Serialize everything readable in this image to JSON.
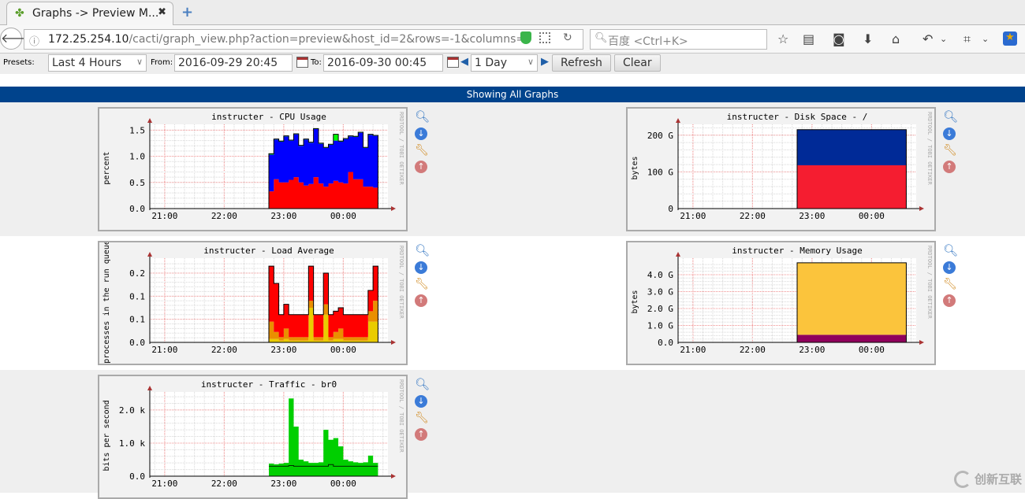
{
  "browser": {
    "tab_title": "Graphs -> Preview M...",
    "url_host": "172.25.254.10",
    "url_path": "/cacti/graph_view.php?action=preview&host_id=2&rows=-1&columns=-",
    "search_placeholder": "百度 <Ctrl+K>"
  },
  "toolbar": {
    "presets_label": "Presets:",
    "preset_value": "Last 4 Hours",
    "from_label": "From:",
    "from_value": "2016-09-29 20:45",
    "to_label": "To:",
    "to_value": "2016-09-30 00:45",
    "span_value": "1 Day",
    "refresh_label": "Refresh",
    "clear_label": "Clear"
  },
  "banner": "Showing All Graphs",
  "watermark": "RRDTOOL / TOBI OETIKER",
  "logo_text": "创新互联",
  "x_ticks": [
    "21:00",
    "22:00",
    "23:00",
    "00:00"
  ],
  "graphs": [
    {
      "title": "instructer - CPU Usage",
      "ylabel": "percent",
      "ymax": 1.55,
      "yticks": [
        {
          "v": 0,
          "l": "0.0"
        },
        {
          "v": 0.5,
          "l": "0.5"
        },
        {
          "v": 1.0,
          "l": "1.0"
        },
        {
          "v": 1.5,
          "l": "1.5"
        }
      ],
      "start": "22:45",
      "end": "00:35",
      "series": [
        {
          "color": "#ff0000",
          "values": [
            0.33,
            0.56,
            0.5,
            0.5,
            0.55,
            0.6,
            0.5,
            0.44,
            0.47,
            0.6,
            0.48,
            0.42,
            0.48,
            0.53,
            0.5,
            0.48,
            0.7,
            0.56,
            0.56,
            0.42,
            0.42,
            0.4
          ]
        },
        {
          "color": "#0000ff",
          "values": [
            0.7,
            0.76,
            0.78,
            0.88,
            0.75,
            0.82,
            0.7,
            0.88,
            0.79,
            0.92,
            0.76,
            0.74,
            0.74,
            0.77,
            0.78,
            0.85,
            0.68,
            0.81,
            0.89,
            0.74,
            0.99,
            0.99
          ]
        },
        {
          "color": "#00ff00",
          "values": [
            0.02,
            0.01,
            0.01,
            0.01,
            0.01,
            0.01,
            0.01,
            0.01,
            0.01,
            0.01,
            0.01,
            0.01,
            0.01,
            0.12,
            0.01,
            0.01,
            0.01,
            0.01,
            0.01,
            0.01,
            0.01,
            0.01
          ]
        }
      ]
    },
    {
      "title": "instructer - Disk Space - /",
      "ylabel": "bytes",
      "ymax": 221,
      "yticks": [
        {
          "v": 0,
          "l": "0"
        },
        {
          "v": 100,
          "l": "100 G"
        },
        {
          "v": 200,
          "l": "200 G"
        }
      ],
      "start": "22:45",
      "end": "00:35",
      "series": [
        {
          "color": "#f51d30",
          "values": [
            118,
            118,
            118,
            118,
            118,
            118,
            118,
            118,
            118,
            118,
            118,
            118,
            118,
            118,
            118,
            118,
            118,
            118,
            118,
            118,
            118,
            118
          ]
        },
        {
          "color": "#002a97",
          "values": [
            97,
            97,
            97,
            97,
            97,
            97,
            97,
            97,
            97,
            97,
            97,
            97,
            97,
            97,
            97,
            97,
            97,
            97,
            97,
            97,
            97,
            97
          ]
        }
      ]
    },
    {
      "title": "instructer - Load Average",
      "ylabel": "processes in the run queue",
      "ymax": 0.234,
      "yticks": [
        {
          "v": 0,
          "l": "0.0"
        },
        {
          "v": 0.0667,
          "l": "0.1"
        },
        {
          "v": 0.1333,
          "l": "0.1"
        },
        {
          "v": 0.2,
          "l": "0.2"
        }
      ],
      "start": "22:45",
      "end": "00:35",
      "series": [
        {
          "color": "#eacc00",
          "values": [
            0.01,
            0.01,
            0.005,
            0.01,
            0.005,
            0.005,
            0.005,
            0.005,
            0.1,
            0.005,
            0.005,
            0.08,
            0.005,
            0.01,
            0.01,
            0.005,
            0.005,
            0.005,
            0.005,
            0.005,
            0.06,
            0.06
          ]
        },
        {
          "color": "#ea8f00",
          "values": [
            0.05,
            0.02,
            0.01,
            0.03,
            0.01,
            0.01,
            0.01,
            0.01,
            0.02,
            0.01,
            0.01,
            0.03,
            0.01,
            0.02,
            0.03,
            0.01,
            0.01,
            0.01,
            0.01,
            0.01,
            0.03,
            0.06
          ]
        },
        {
          "color": "#ff0000",
          "values": [
            0.16,
            0.14,
            0.065,
            0.07,
            0.065,
            0.065,
            0.065,
            0.065,
            0.1,
            0.065,
            0.065,
            0.09,
            0.065,
            0.06,
            0.06,
            0.065,
            0.065,
            0.065,
            0.065,
            0.065,
            0.06,
            0.1
          ]
        }
      ]
    },
    {
      "title": "instructer - Memory Usage",
      "ylabel": "bytes",
      "ymax": 4.79,
      "yticks": [
        {
          "v": 0,
          "l": "0.0"
        },
        {
          "v": 1,
          "l": "1.0 G"
        },
        {
          "v": 2,
          "l": "2.0 G"
        },
        {
          "v": 3,
          "l": "3.0 G"
        },
        {
          "v": 4,
          "l": "4.0 G"
        }
      ],
      "start": "22:45",
      "end": "00:35",
      "series": [
        {
          "color": "#8f005c",
          "values": [
            0.45,
            0.45,
            0.45,
            0.45,
            0.45,
            0.45,
            0.45,
            0.45,
            0.45,
            0.45,
            0.45,
            0.45,
            0.45,
            0.45,
            0.45,
            0.45,
            0.45,
            0.45,
            0.45,
            0.45,
            0.45,
            0.45
          ]
        },
        {
          "color": "#fbc43c",
          "values": [
            4.25,
            4.25,
            4.25,
            4.25,
            4.25,
            4.25,
            4.25,
            4.25,
            4.25,
            4.25,
            4.25,
            4.25,
            4.25,
            4.25,
            4.25,
            4.25,
            4.25,
            4.25,
            4.25,
            4.25,
            4.25,
            4.25
          ]
        }
      ]
    },
    {
      "title": "instructer - Traffic - br0",
      "ylabel": "bits per second",
      "ymax": 2.45,
      "yticks": [
        {
          "v": 0,
          "l": "0.0"
        },
        {
          "v": 1,
          "l": "1.0 k"
        },
        {
          "v": 2,
          "l": "2.0 k"
        }
      ],
      "start": "22:45",
      "end": "00:35",
      "series": [
        {
          "color": "#00cf00",
          "values": [
            0.38,
            0.36,
            0.38,
            0.4,
            2.35,
            1.5,
            0.5,
            0.45,
            0.4,
            0.4,
            0.42,
            1.4,
            1.1,
            1.15,
            0.9,
            0.5,
            0.45,
            0.42,
            0.4,
            0.42,
            0.62,
            0.4
          ]
        }
      ],
      "line": {
        "color": "#002a00",
        "values": [
          0.3,
          0.3,
          0.3,
          0.3,
          0.32,
          0.3,
          0.3,
          0.3,
          0.3,
          0.3,
          0.3,
          0.3,
          0.35,
          0.3,
          0.3,
          0.3,
          0.3,
          0.3,
          0.3,
          0.3,
          0.3,
          0.3
        ]
      }
    }
  ]
}
